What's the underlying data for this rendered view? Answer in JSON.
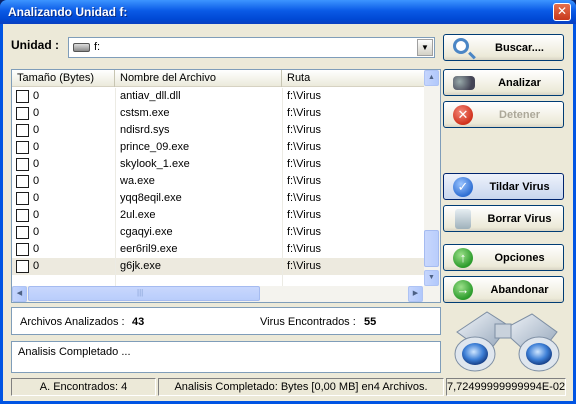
{
  "window": {
    "title": "Analizando Unidad f:",
    "close_glyph": "✕"
  },
  "drive": {
    "label": "Unidad :",
    "value": "f:",
    "icon": "drive-icon"
  },
  "table": {
    "columns": [
      "Tamaño (Bytes)",
      "Nombre del Archivo",
      "Ruta"
    ],
    "rows": [
      {
        "size": "0",
        "name": "antiav_dll.dll",
        "path": "f:\\Virus"
      },
      {
        "size": "0",
        "name": "cstsm.exe",
        "path": "f:\\Virus"
      },
      {
        "size": "0",
        "name": "ndisrd.sys",
        "path": "f:\\Virus"
      },
      {
        "size": "0",
        "name": "prince_09.exe",
        "path": "f:\\Virus"
      },
      {
        "size": "0",
        "name": "skylook_1.exe",
        "path": "f:\\Virus"
      },
      {
        "size": "0",
        "name": "wa.exe",
        "path": "f:\\Virus"
      },
      {
        "size": "0",
        "name": "yqq8eqil.exe",
        "path": "f:\\Virus"
      },
      {
        "size": "0",
        "name": "2ul.exe",
        "path": "f:\\Virus"
      },
      {
        "size": "0",
        "name": "cgaqyi.exe",
        "path": "f:\\Virus"
      },
      {
        "size": "0",
        "name": "eer6ril9.exe",
        "path": "f:\\Virus"
      },
      {
        "size": "0",
        "name": "g6jk.exe",
        "path": "f:\\Virus"
      }
    ],
    "hscroll_grip": "|||"
  },
  "buttons": {
    "buscar": "Buscar....",
    "analizar": "Analizar",
    "detener": "Detener",
    "tildar": "Tildar Virus",
    "borrar": "Borrar Virus",
    "opciones": "Opciones",
    "abandonar": "Abandonar"
  },
  "stats": {
    "analizados_label": "Archivos Analizados :",
    "analizados_value": "43",
    "encontrados_label": "Virus Encontrados :",
    "encontrados_value": "55"
  },
  "log": {
    "text": "Analisis Completado ..."
  },
  "status": {
    "seg1": "A. Encontrados: 4",
    "seg2": "Analisis Completado:  Bytes [0,00 MB] en4 Archivos.",
    "seg3": "7,72499999999994E-02"
  }
}
